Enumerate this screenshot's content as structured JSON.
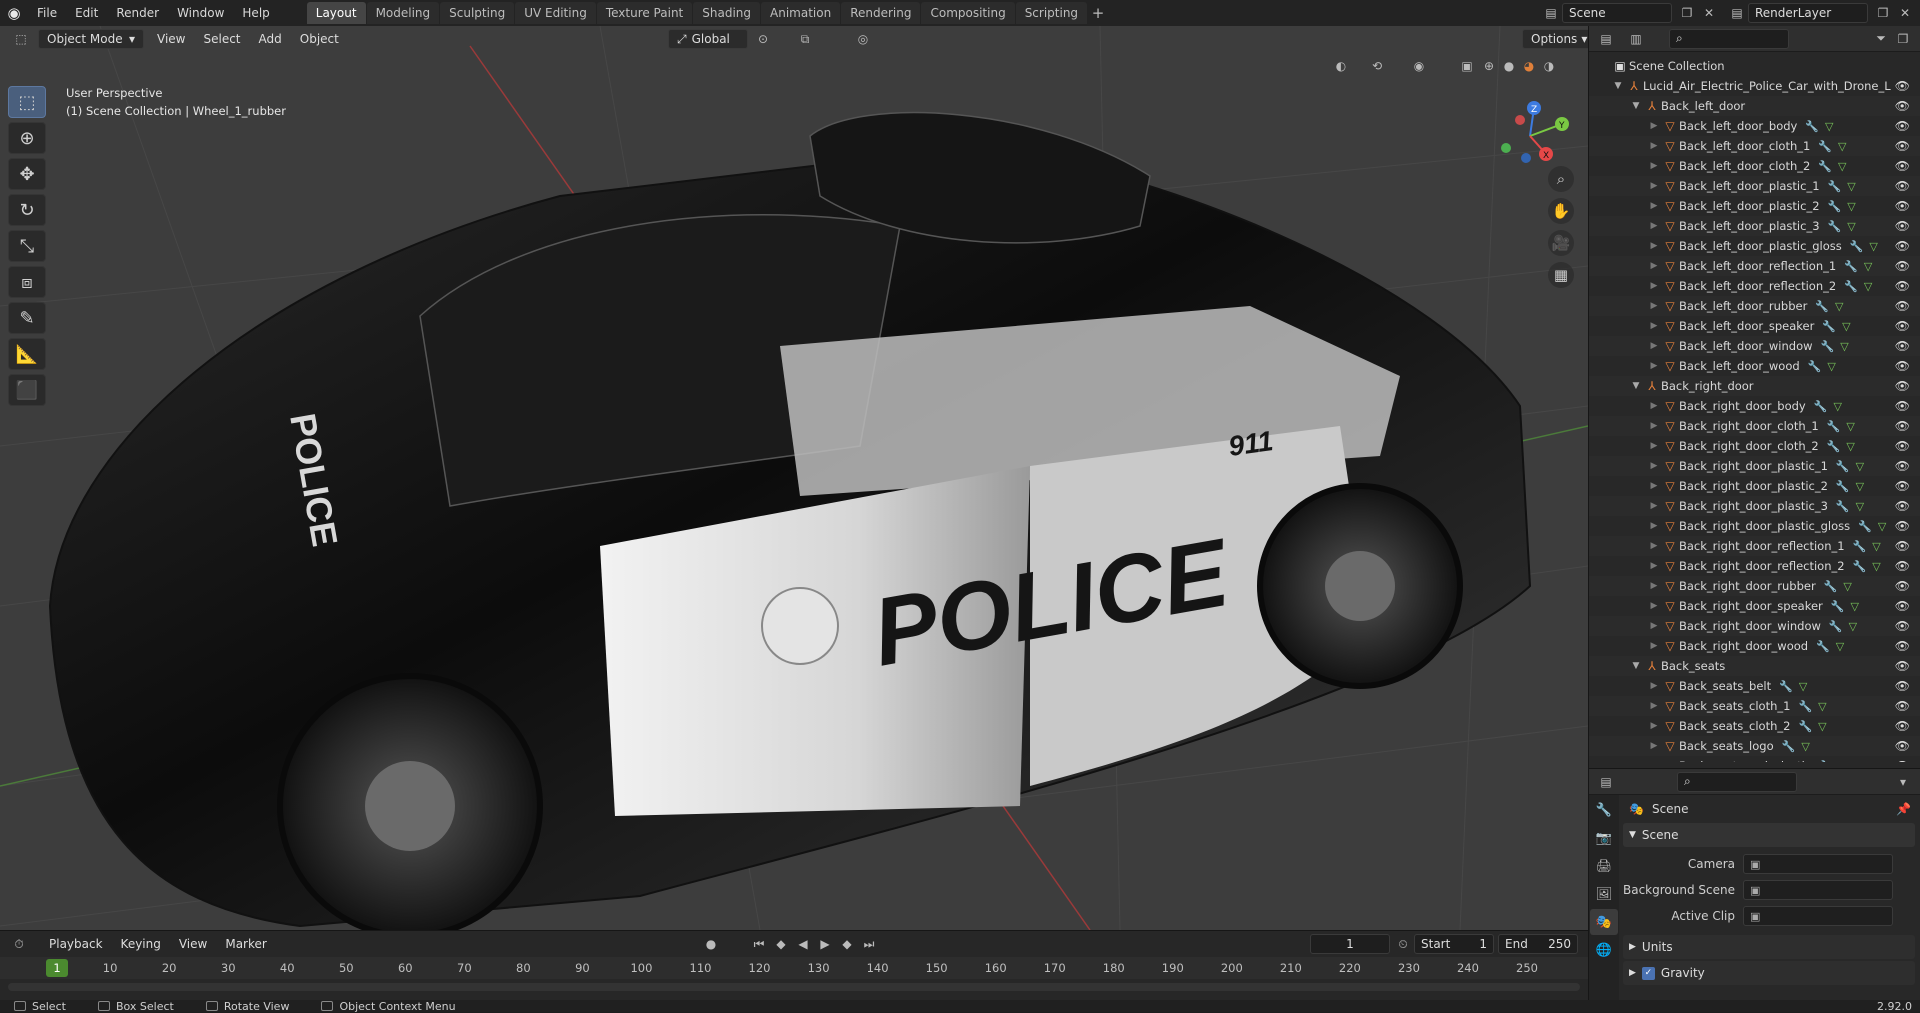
{
  "app": {
    "name": "Blender",
    "version": "2.92.0"
  },
  "top_menu": [
    "File",
    "Edit",
    "Render",
    "Window",
    "Help"
  ],
  "workspaces": [
    "Layout",
    "Modeling",
    "Sculpting",
    "UV Editing",
    "Texture Paint",
    "Shading",
    "Animation",
    "Rendering",
    "Compositing",
    "Scripting"
  ],
  "active_workspace": "Layout",
  "scene_name": "Scene",
  "view_layer": "RenderLayer",
  "viewport": {
    "mode": "Object Mode",
    "menus": [
      "View",
      "Select",
      "Add",
      "Object"
    ],
    "transform_orientation": "Global",
    "options_label": "Options",
    "overlay_title": "User Perspective",
    "overlay_subtitle": "(1) Scene Collection | Wheel_1_rubber",
    "car_texts": {
      "hood": "POLICE",
      "door": "POLICE",
      "unit_number": "911"
    },
    "tools": [
      "select-box",
      "cursor",
      "move",
      "rotate",
      "scale",
      "transform",
      "annotate",
      "measure",
      "add-cube"
    ],
    "nav": [
      "zoom",
      "pan",
      "camera",
      "perspective"
    ],
    "gizmo_axes": [
      "Z",
      "Y",
      "X"
    ]
  },
  "outliner": {
    "root": "Scene Collection",
    "rows": [
      {
        "name": "Lucid_Air_Electric_Police_Car_with_Drone_L",
        "level": 1,
        "type": "empty",
        "expanded": true
      },
      {
        "name": "Back_left_door",
        "level": 2,
        "type": "empty",
        "expanded": true
      },
      {
        "name": "Back_left_door_body",
        "level": 3,
        "type": "mesh"
      },
      {
        "name": "Back_left_door_cloth_1",
        "level": 3,
        "type": "mesh"
      },
      {
        "name": "Back_left_door_cloth_2",
        "level": 3,
        "type": "mesh"
      },
      {
        "name": "Back_left_door_plastic_1",
        "level": 3,
        "type": "mesh"
      },
      {
        "name": "Back_left_door_plastic_2",
        "level": 3,
        "type": "mesh"
      },
      {
        "name": "Back_left_door_plastic_3",
        "level": 3,
        "type": "mesh"
      },
      {
        "name": "Back_left_door_plastic_gloss",
        "level": 3,
        "type": "mesh"
      },
      {
        "name": "Back_left_door_reflection_1",
        "level": 3,
        "type": "mesh"
      },
      {
        "name": "Back_left_door_reflection_2",
        "level": 3,
        "type": "mesh"
      },
      {
        "name": "Back_left_door_rubber",
        "level": 3,
        "type": "mesh"
      },
      {
        "name": "Back_left_door_speaker",
        "level": 3,
        "type": "mesh"
      },
      {
        "name": "Back_left_door_window",
        "level": 3,
        "type": "mesh"
      },
      {
        "name": "Back_left_door_wood",
        "level": 3,
        "type": "mesh"
      },
      {
        "name": "Back_right_door",
        "level": 2,
        "type": "empty",
        "expanded": true
      },
      {
        "name": "Back_right_door_body",
        "level": 3,
        "type": "mesh"
      },
      {
        "name": "Back_right_door_cloth_1",
        "level": 3,
        "type": "mesh"
      },
      {
        "name": "Back_right_door_cloth_2",
        "level": 3,
        "type": "mesh"
      },
      {
        "name": "Back_right_door_plastic_1",
        "level": 3,
        "type": "mesh"
      },
      {
        "name": "Back_right_door_plastic_2",
        "level": 3,
        "type": "mesh"
      },
      {
        "name": "Back_right_door_plastic_3",
        "level": 3,
        "type": "mesh"
      },
      {
        "name": "Back_right_door_plastic_gloss",
        "level": 3,
        "type": "mesh"
      },
      {
        "name": "Back_right_door_reflection_1",
        "level": 3,
        "type": "mesh"
      },
      {
        "name": "Back_right_door_reflection_2",
        "level": 3,
        "type": "mesh"
      },
      {
        "name": "Back_right_door_rubber",
        "level": 3,
        "type": "mesh"
      },
      {
        "name": "Back_right_door_speaker",
        "level": 3,
        "type": "mesh"
      },
      {
        "name": "Back_right_door_window",
        "level": 3,
        "type": "mesh"
      },
      {
        "name": "Back_right_door_wood",
        "level": 3,
        "type": "mesh"
      },
      {
        "name": "Back_seats",
        "level": 2,
        "type": "empty",
        "expanded": true
      },
      {
        "name": "Back_seats_belt",
        "level": 3,
        "type": "mesh"
      },
      {
        "name": "Back_seats_cloth_1",
        "level": 3,
        "type": "mesh"
      },
      {
        "name": "Back_seats_cloth_2",
        "level": 3,
        "type": "mesh"
      },
      {
        "name": "Back_seats_logo",
        "level": 3,
        "type": "mesh"
      },
      {
        "name": "Back_seats_red_plastic",
        "level": 3,
        "type": "mesh"
      }
    ]
  },
  "properties": {
    "context_title": "Scene",
    "panel_title": "Scene",
    "fields": [
      {
        "label": "Camera",
        "value": ""
      },
      {
        "label": "Background Scene",
        "value": ""
      },
      {
        "label": "Active Clip",
        "value": ""
      }
    ],
    "sub_panels": [
      "Units",
      "Gravity"
    ]
  },
  "timeline": {
    "menus": [
      "Playback",
      "Keying",
      "View",
      "Marker"
    ],
    "current_frame": "1",
    "start_label": "Start",
    "start": "1",
    "end_label": "End",
    "end": "250",
    "ruler": [
      1,
      10,
      20,
      30,
      40,
      50,
      60,
      70,
      80,
      90,
      100,
      110,
      120,
      130,
      140,
      150,
      160,
      170,
      180,
      190,
      200,
      210,
      220,
      230,
      240,
      250
    ]
  },
  "statusbar": [
    "Select",
    "Box Select",
    "Rotate View",
    "Object Context Menu"
  ],
  "colors": {
    "accent": "#4a5f7d",
    "object_orange": "#e6803b",
    "frame_green": "#4b8a2f",
    "axis_x": "#e54848",
    "axis_y": "#7ac943",
    "axis_z": "#3d7be0"
  }
}
